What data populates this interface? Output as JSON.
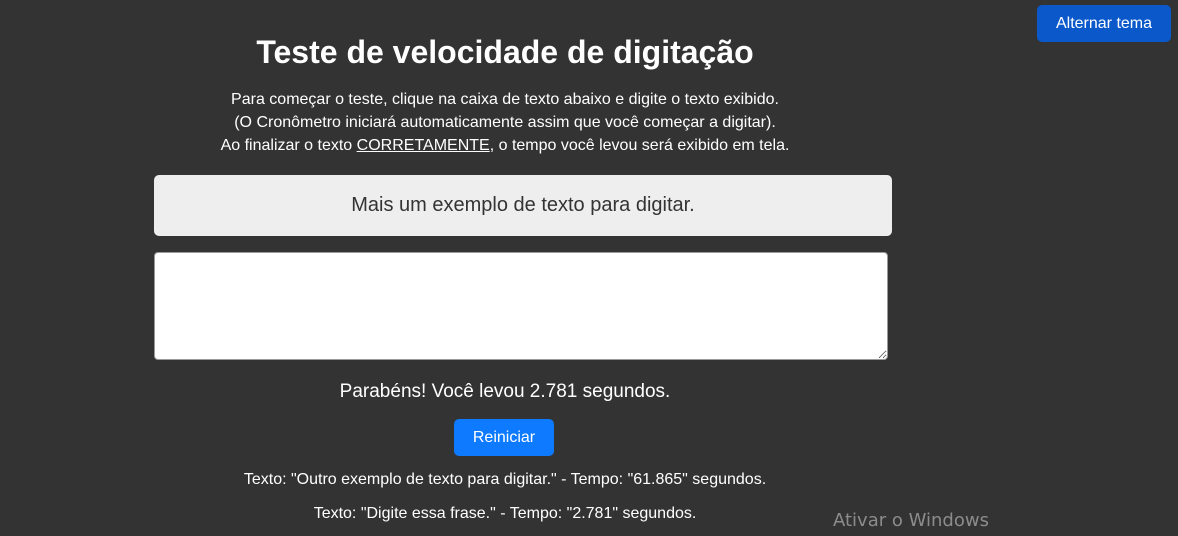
{
  "header": {
    "theme_toggle_label": "Alternar tema",
    "title": "Teste de velocidade de digitação"
  },
  "instructions": {
    "line1": "Para começar o teste, clique na caixa de texto abaixo e digite o texto exibido.",
    "line2": "(O Cronômetro iniciará automaticamente assim que você começar a digitar).",
    "line3_before": "Ao finalizar o texto ",
    "line3_emphasis": "CORRETAMENTE",
    "line3_after": ", o tempo você levou será exibido em tela."
  },
  "sample": {
    "text": "Mais um exemplo de texto para digitar."
  },
  "typing_area": {
    "value": "",
    "placeholder": ""
  },
  "result": {
    "message": "Parabéns! Você levou 2.781 segundos."
  },
  "restart_button": {
    "label": "Reiniciar"
  },
  "history": [
    {
      "text": "Texto: \"Outro exemplo de texto para digitar.\" - Tempo: \"61.865\" segundos."
    },
    {
      "text": "Texto: \"Digite essa frase.\" - Tempo: \"2.781\" segundos."
    }
  ],
  "watermark": {
    "text": "Ativar o Windows"
  },
  "colors": {
    "background": "#333333",
    "sample_box": "#eeeeee",
    "restart_button": "#0d7aff",
    "theme_toggle": "#0a58ca"
  }
}
